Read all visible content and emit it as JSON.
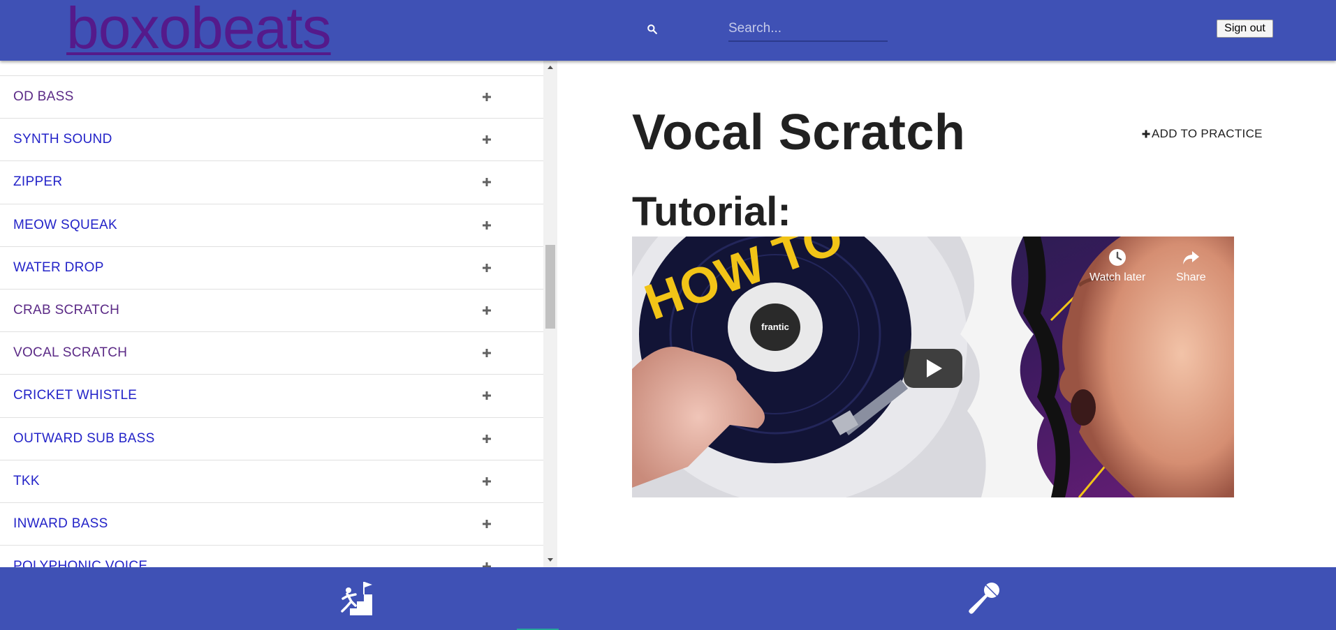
{
  "header": {
    "logo": "boxobeats",
    "search_placeholder": "Search...",
    "sign_out_label": "Sign out"
  },
  "sidebar": {
    "items": [
      {
        "label": "OD BASS",
        "visited": true
      },
      {
        "label": "SYNTH SOUND",
        "visited": false
      },
      {
        "label": "ZIPPER",
        "visited": false
      },
      {
        "label": "MEOW SQUEAK",
        "visited": false
      },
      {
        "label": "WATER DROP",
        "visited": false
      },
      {
        "label": "CRAB SCRATCH",
        "visited": true
      },
      {
        "label": "VOCAL SCRATCH",
        "visited": true
      },
      {
        "label": "CRICKET WHISTLE",
        "visited": false
      },
      {
        "label": "OUTWARD SUB BASS",
        "visited": false
      },
      {
        "label": "TKK",
        "visited": false
      },
      {
        "label": "INWARD BASS",
        "visited": false
      },
      {
        "label": "POLYPHONIC VOICE",
        "visited": false
      }
    ]
  },
  "main": {
    "title": "Vocal Scratch",
    "add_to_practice_label": "ADD TO PRACTICE",
    "tutorial_label": "Tutorial:",
    "video": {
      "thumbnail_text": "HOW TO",
      "watch_later_label": "Watch later",
      "share_label": "Share"
    }
  },
  "bottom_nav": {
    "items": [
      {
        "icon": "practice-stairs-icon"
      },
      {
        "icon": "microphone-icon"
      }
    ]
  },
  "colors": {
    "header": "#3f51b5",
    "link_unvisited": "#2323c8",
    "link_visited": "#5b2a86",
    "nav_indicator": "#26a69a"
  }
}
